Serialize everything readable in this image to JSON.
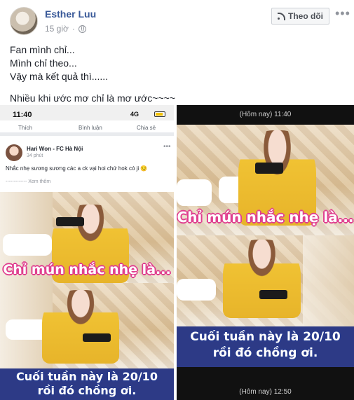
{
  "post": {
    "author": "Esther Luu",
    "time": "15 giờ",
    "follow_label": "Theo dõi",
    "more": "•••",
    "lines": [
      "Fan mình chỉ...",
      "Mình chỉ theo...",
      "Vậy mà kết quả thì......"
    ],
    "final_line": "Nhiều khi ước mơ chỉ là mơ ước~~~~"
  },
  "left_image": {
    "status_time": "11:40",
    "status_signal": "4G",
    "actions": [
      "Thích",
      "Bình luận",
      "Chia sẻ"
    ],
    "card_name": "Hari Won - FC Hà Nội",
    "card_time": "34 phút",
    "card_text": "Nhắc nhẹ sương sương các a ck vại hoi chứ hok có ji 😏",
    "see_more": "------------- Xem thêm",
    "caption_top": "Chỉ mún nhắc nhẹ là...",
    "caption_bottom_1": "Cuối tuần này là 20/10",
    "caption_bottom_2": "rồi đó chồng ơi."
  },
  "right_image": {
    "timestamp_top": "(Hôm nay) 11:40",
    "caption_mid": "Chỉ mún nhắc nhẹ là...",
    "caption_bottom_1": "Cuối tuần này là 20/10",
    "caption_bottom_2": "rồi đó chồng ơi.",
    "timestamp_bottom": "(Hôm nay) 12:50"
  },
  "colors": {
    "link": "#385898",
    "caption_pink": "#e03f8f",
    "caption_blue": "#283a8c"
  },
  "icons": [
    "globe-icon",
    "rss-icon",
    "more-icon"
  ]
}
